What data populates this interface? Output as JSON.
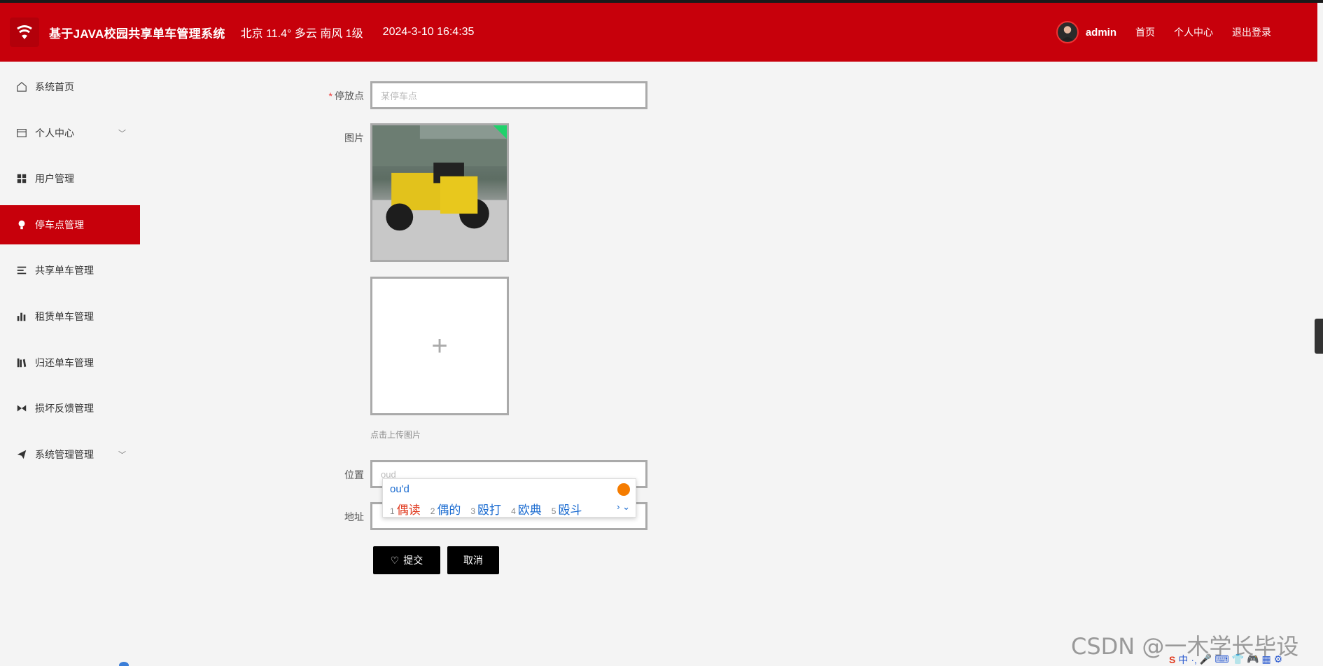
{
  "header": {
    "system_title": "基于JAVA校园共享单车管理系统",
    "weather": "北京  11.4°  多云  南风  1级",
    "datetime": "2024-3-10 16:4:35",
    "username": "admin",
    "links": [
      "首页",
      "个人中心",
      "退出登录"
    ],
    "bg_color": "#c7000b"
  },
  "sidebar": {
    "items": [
      {
        "label": "系统首页",
        "icon": "home-icon"
      },
      {
        "label": "个人中心",
        "icon": "id-card-icon"
      },
      {
        "label": "用户管理",
        "icon": "grid-icon"
      },
      {
        "label": "停车点管理",
        "icon": "bulb-icon"
      },
      {
        "label": "共享单车管理",
        "icon": "list-icon"
      },
      {
        "label": "租赁单车管理",
        "icon": "bar-chart-icon"
      },
      {
        "label": "归还单车管理",
        "icon": "books-icon"
      },
      {
        "label": "损坏反馈管理",
        "icon": "bow-icon"
      },
      {
        "label": "系统管理管理",
        "icon": "send-icon"
      }
    ],
    "chevron": "﹀"
  },
  "form": {
    "parking_label": "停放点",
    "parking_required": "*",
    "parking_placeholder": "某停车点",
    "image_label": "图片",
    "upload_plus": "+",
    "upload_hint": "点击上传图片",
    "location_label": "位置",
    "location_value": "oud",
    "address_label": "地址",
    "submit_label": "提交",
    "cancel_label": "取消"
  },
  "ime": {
    "composition": "ou'd",
    "candidates": [
      {
        "n": "1",
        "text": "偶读"
      },
      {
        "n": "2",
        "text": "偶的"
      },
      {
        "n": "3",
        "text": "殴打"
      },
      {
        "n": "4",
        "text": "欧典"
      },
      {
        "n": "5",
        "text": "殴斗"
      }
    ],
    "more": "› ⌄"
  },
  "watermark": "CSDN @一木学长毕设",
  "tray": [
    "中",
    "·,",
    "🎤",
    "⌨",
    "👕",
    "🎮",
    "▦",
    "⚙"
  ]
}
